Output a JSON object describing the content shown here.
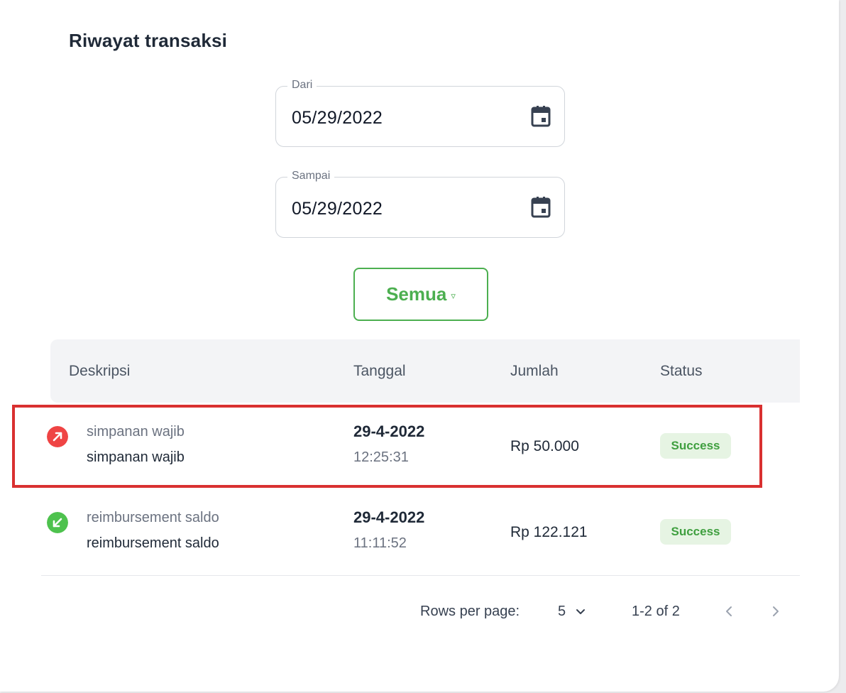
{
  "page": {
    "title": "Riwayat transaksi"
  },
  "filters": {
    "from": {
      "label": "Dari",
      "value": "05/29/2022",
      "icon": "calendar-icon"
    },
    "to": {
      "label": "Sampai",
      "value": "05/29/2022",
      "icon": "calendar-icon"
    },
    "type_filter": {
      "label": "Semua",
      "icon": "triangle-down-icon"
    }
  },
  "table": {
    "headers": [
      "Deskripsi",
      "Tanggal",
      "Jumlah",
      "Status"
    ],
    "rows": [
      {
        "direction": "outgoing",
        "icon": "arrow-up-right-icon",
        "icon_color": "#ef4444",
        "title": "simpanan wajib",
        "subtitle": "simpanan wajib",
        "date": "29-4-2022",
        "time": "12:25:31",
        "amount": "Rp 50.000",
        "status": "Success"
      },
      {
        "direction": "incoming",
        "icon": "arrow-down-left-icon",
        "icon_color": "#4ec24e",
        "title": "reimbursement saldo",
        "subtitle": "reimbursement saldo",
        "date": "29-4-2022",
        "time": "11:11:52",
        "amount": "Rp 122.121",
        "status": "Success"
      }
    ]
  },
  "pagination": {
    "rows_per_page_label": "Rows per page:",
    "rows_per_page": "5",
    "range": "1-2 of 2"
  },
  "colors": {
    "accent": "#4caf50",
    "success_bg": "#e6f4e3",
    "highlight_border": "#d93030"
  }
}
